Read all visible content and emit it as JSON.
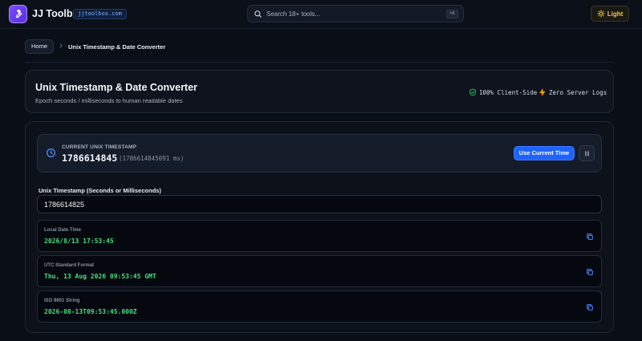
{
  "header": {
    "brand": "JJ Toolbox",
    "domain_badge": "jjtoolbox.com",
    "search_placeholder": "Search 18+ tools...",
    "search_shortcut": "⌘K",
    "theme_toggle_label": "Light",
    "icons": {
      "logo": "wrench-icon",
      "search": "search-icon",
      "theme": "sun-icon"
    }
  },
  "breadcrumb": {
    "home": "Home",
    "current": "Unix Timestamp & Date Converter"
  },
  "title_card": {
    "title": "Unix Timestamp & Date Converter",
    "subtitle": "Epoch seconds / milliseconds to human readable dates",
    "tags": [
      {
        "label": "100% Client-Side",
        "icon": "shield-check-icon",
        "color": "#22c55e"
      },
      {
        "label": "Zero Server Logs",
        "icon": "bolt-icon",
        "color": "#f59e0b"
      }
    ]
  },
  "current_timestamp": {
    "label": "CURRENT UNIX TIMESTAMP",
    "seconds": "1786614845",
    "milliseconds": "(1786614845091 ms)",
    "use_button": "Use Current Time",
    "icons": {
      "clock": "clock-icon",
      "pause": "pause-icon"
    }
  },
  "input": {
    "label": "Unix Timestamp (Seconds or Milliseconds)",
    "value": "1786614825"
  },
  "results": [
    {
      "label": "Local Date Time",
      "value": "2026/8/13 17:53:45"
    },
    {
      "label": "UTC Standard Format",
      "value": "Thu, 13 Aug 2026 09:53:45 GMT"
    },
    {
      "label": "ISO 8601 String",
      "value": "2026-08-13T09:53:45.000Z"
    }
  ],
  "colors": {
    "accent": "#1f63ff",
    "result_text": "#4ade80",
    "theme_text": "#f7c948",
    "background": "#0a0e17"
  }
}
